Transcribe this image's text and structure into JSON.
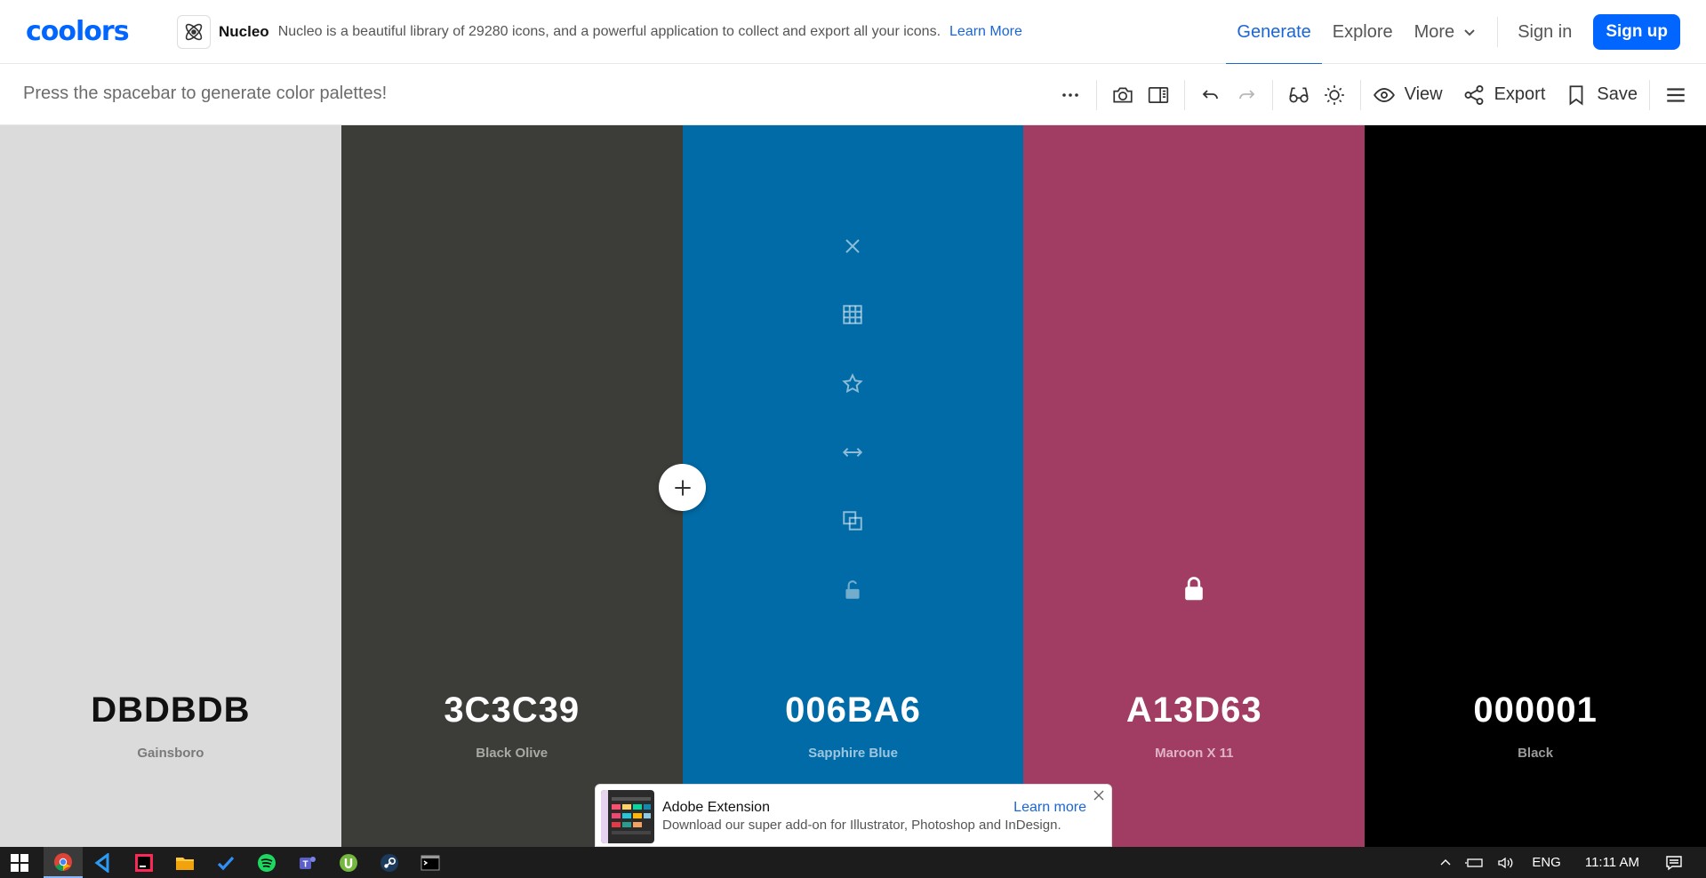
{
  "header": {
    "logo": "coolors",
    "promo": {
      "name": "Nucleo",
      "text": "Nucleo is a beautiful library of 29280 icons, and a powerful application to collect and export all your icons.",
      "link": "Learn More"
    },
    "nav": {
      "generate": "Generate",
      "explore": "Explore",
      "more": "More",
      "signin": "Sign in",
      "signup": "Sign up"
    }
  },
  "toolbar": {
    "hint": "Press the spacebar to generate color palettes!",
    "view_label": "View",
    "export_label": "Export",
    "save_label": "Save"
  },
  "palette": {
    "colors": [
      {
        "hex": "DBDBDB",
        "name": "Gainsboro",
        "bg": "#DBDBDB",
        "text": "#111111",
        "sub": "#7a7a7a"
      },
      {
        "hex": "3C3C39",
        "name": "Black Olive",
        "bg": "#3C3C39",
        "text": "#ffffff",
        "sub": "#a8a8a4"
      },
      {
        "hex": "006BA6",
        "name": "Sapphire Blue",
        "bg": "#006BA6",
        "text": "#ffffff",
        "sub": "#9cc6e0"
      },
      {
        "hex": "A13D63",
        "name": "Maroon X 11",
        "bg": "#A13D63",
        "text": "#ffffff",
        "sub": "#e0b4c5"
      },
      {
        "hex": "000001",
        "name": "Black",
        "bg": "#000001",
        "text": "#ffffff",
        "sub": "#9a9a9a"
      }
    ]
  },
  "ad": {
    "title": "Adobe Extension",
    "subtitle": "Download our super add-on for Illustrator, Photoshop and InDesign.",
    "link": "Learn more"
  },
  "taskbar": {
    "language": "ENG",
    "time": "11:11 AM"
  },
  "colors": {
    "accent": "#0066ff",
    "link": "#1a66d6"
  }
}
